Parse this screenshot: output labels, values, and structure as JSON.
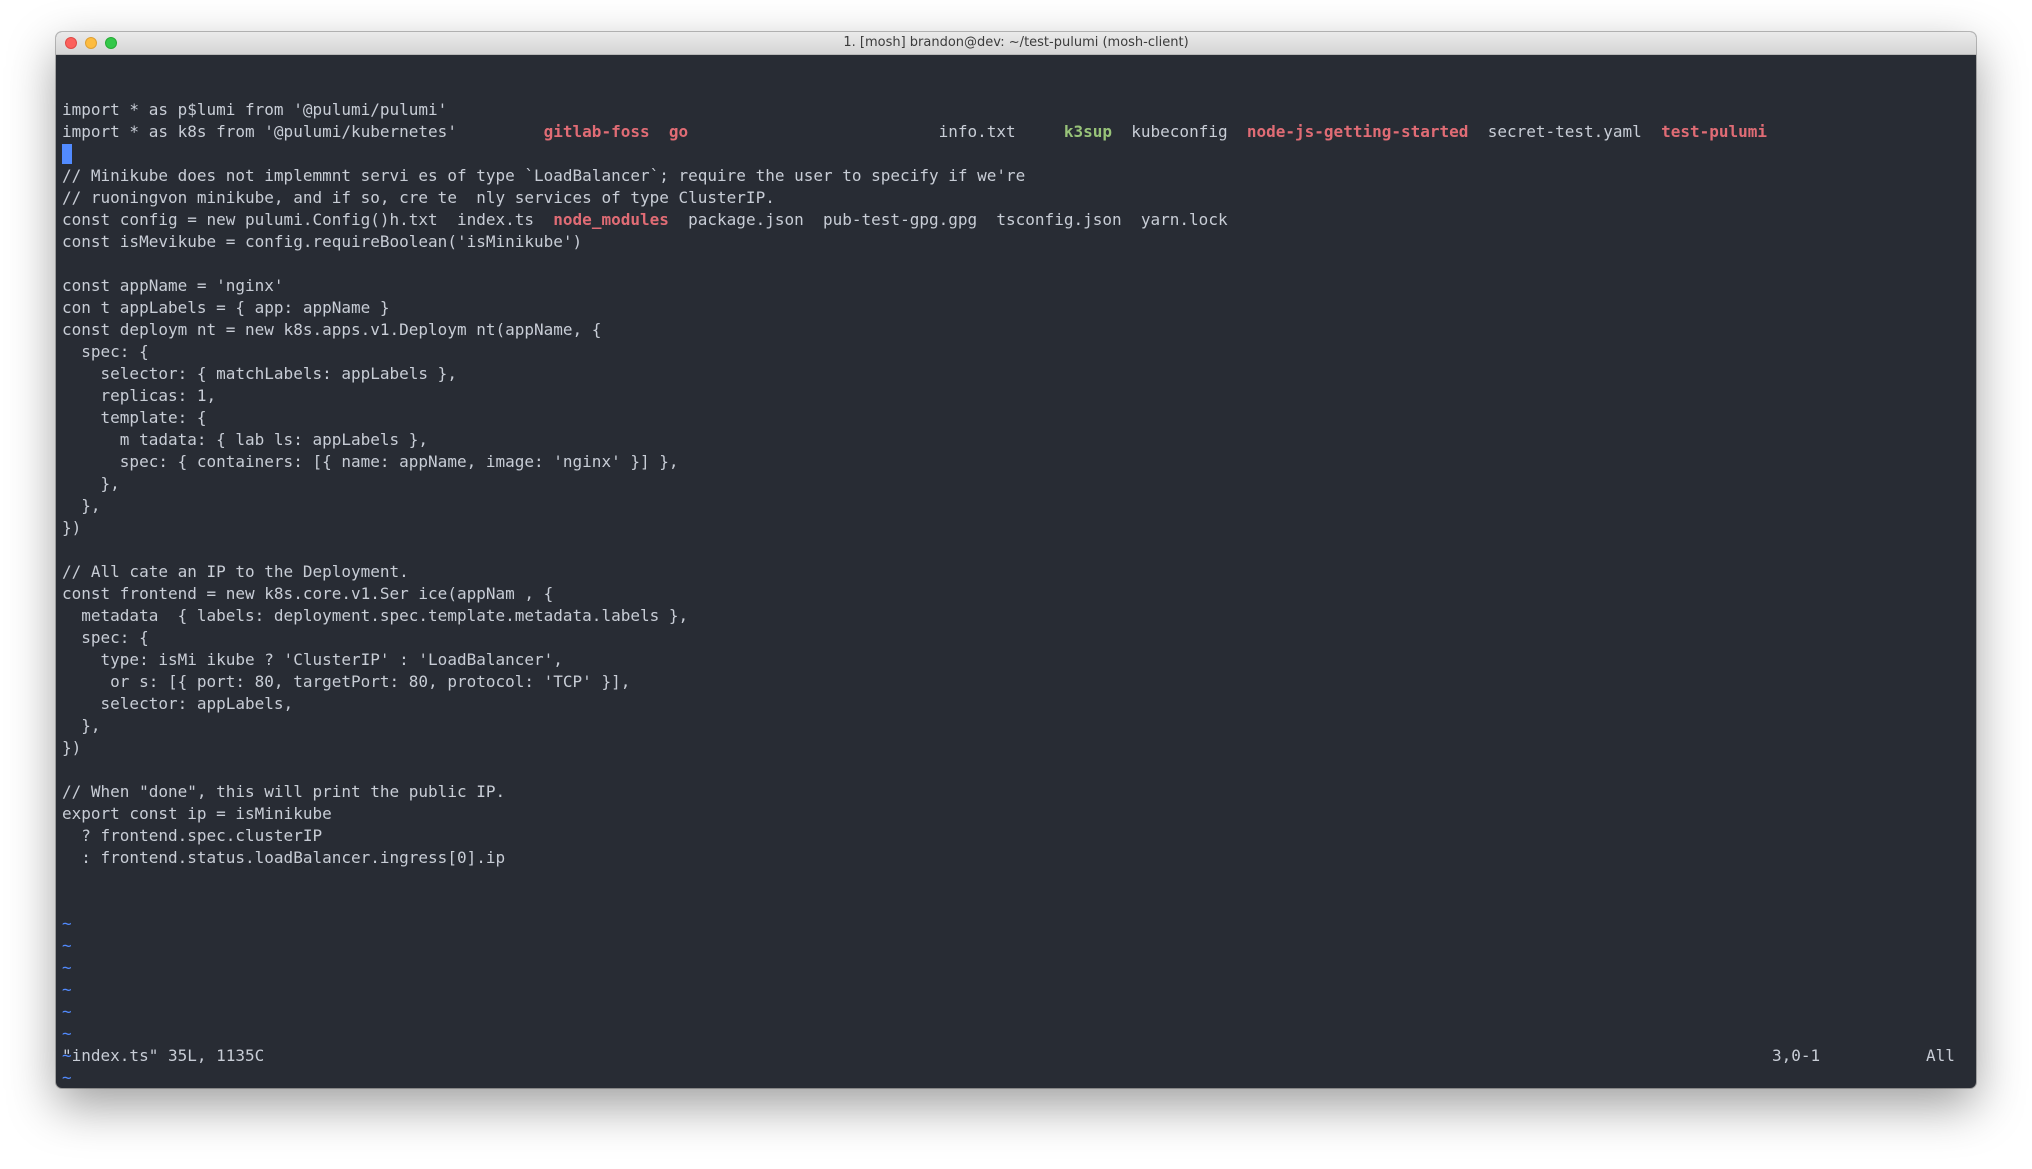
{
  "window": {
    "title": "1. [mosh] brandon@dev: ~/test-pulumi (mosh-client)"
  },
  "editor": {
    "lines": [
      {
        "segs": [
          {
            "t": "import * as p$lumi from '@pulumi/pulumi'",
            "c": "plain"
          }
        ]
      },
      {
        "segs": [
          {
            "t": "import * as k8s from '@pulumi/kubernetes'         ",
            "c": "plain"
          },
          {
            "t": "gitlab-foss",
            "c": "red"
          },
          {
            "t": "  ",
            "c": "plain"
          },
          {
            "t": "go",
            "c": "red"
          },
          {
            "t": "                          info.txt     ",
            "c": "plain"
          },
          {
            "t": "k3sup",
            "c": "green"
          },
          {
            "t": "  kubeconfig  ",
            "c": "plain"
          },
          {
            "t": "node-js-getting-started",
            "c": "red"
          },
          {
            "t": "  secret-test.yaml  ",
            "c": "plain"
          },
          {
            "t": "test-pulumi",
            "c": "red"
          }
        ]
      },
      {
        "cursor": true,
        "segs": []
      },
      {
        "segs": [
          {
            "t": "// Minikube does not implemmnt servi es of type `LoadBalancer`; require the user to specify if we're",
            "c": "plain"
          }
        ]
      },
      {
        "segs": [
          {
            "t": "// ruoningvon minikube, and if so, cre te  nly services of type ClusterIP.",
            "c": "plain"
          }
        ]
      },
      {
        "segs": [
          {
            "t": "const config = new pulumi.Config()h.txt  index.ts  ",
            "c": "plain"
          },
          {
            "t": "node_modules",
            "c": "red"
          },
          {
            "t": "  package.json  pub-test-gpg.gpg  tsconfig.json  yarn.lock",
            "c": "plain"
          }
        ]
      },
      {
        "segs": [
          {
            "t": "const isMevikube = config.requireBoolean('isMinikube')",
            "c": "plain"
          }
        ]
      },
      {
        "segs": []
      },
      {
        "segs": [
          {
            "t": "const appName = 'nginx'",
            "c": "plain"
          }
        ]
      },
      {
        "segs": [
          {
            "t": "con t appLabels = { app: appName }",
            "c": "plain"
          }
        ]
      },
      {
        "segs": [
          {
            "t": "const deploym nt = new k8s.apps.v1.Deploym nt(appName, {",
            "c": "plain"
          }
        ]
      },
      {
        "segs": [
          {
            "t": "  spec: {",
            "c": "plain"
          }
        ]
      },
      {
        "segs": [
          {
            "t": "    selector: { matchLabels: appLabels },",
            "c": "plain"
          }
        ]
      },
      {
        "segs": [
          {
            "t": "    replicas: 1,",
            "c": "plain"
          }
        ]
      },
      {
        "segs": [
          {
            "t": "    template: {",
            "c": "plain"
          }
        ]
      },
      {
        "segs": [
          {
            "t": "      m tadata: { lab ls: appLabels },",
            "c": "plain"
          }
        ]
      },
      {
        "segs": [
          {
            "t": "      spec: { containers: [{ name: appName, image: 'nginx' }] },",
            "c": "plain"
          }
        ]
      },
      {
        "segs": [
          {
            "t": "    },",
            "c": "plain"
          }
        ]
      },
      {
        "segs": [
          {
            "t": "  },",
            "c": "plain"
          }
        ]
      },
      {
        "segs": [
          {
            "t": "})",
            "c": "plain"
          }
        ]
      },
      {
        "segs": []
      },
      {
        "segs": [
          {
            "t": "// All cate an IP to the Deployment.",
            "c": "plain"
          }
        ]
      },
      {
        "segs": [
          {
            "t": "const frontend = new k8s.core.v1.Ser ice(appNam , {",
            "c": "plain"
          }
        ]
      },
      {
        "segs": [
          {
            "t": "  metadata  { labels: deployment.spec.template.metadata.labels },",
            "c": "plain"
          }
        ]
      },
      {
        "segs": [
          {
            "t": "  spec: {",
            "c": "plain"
          }
        ]
      },
      {
        "segs": [
          {
            "t": "    type: isMi ikube ? 'ClusterIP' : 'LoadBalancer',",
            "c": "plain"
          }
        ]
      },
      {
        "segs": [
          {
            "t": "     or s: [{ port: 80, targetPort: 80, protocol: 'TCP' }],",
            "c": "plain"
          }
        ]
      },
      {
        "segs": [
          {
            "t": "    selector: appLabels,",
            "c": "plain"
          }
        ]
      },
      {
        "segs": [
          {
            "t": "  },",
            "c": "plain"
          }
        ]
      },
      {
        "segs": [
          {
            "t": "})",
            "c": "plain"
          }
        ]
      },
      {
        "segs": []
      },
      {
        "segs": [
          {
            "t": "// When \"done\", this will print the public IP.",
            "c": "plain"
          }
        ]
      },
      {
        "segs": [
          {
            "t": "export const ip = isMinikube",
            "c": "plain"
          }
        ]
      },
      {
        "segs": [
          {
            "t": "  ? frontend.spec.clusterIP",
            "c": "plain"
          }
        ]
      },
      {
        "segs": [
          {
            "t": "  : frontend.status.loadBalancer.ingress[0].ip",
            "c": "plain"
          }
        ]
      }
    ],
    "tilde_char": "~",
    "tilde_count": 10,
    "status": {
      "file_info": "\"index.ts\" 35L, 1135C",
      "position": "3,0-1",
      "scroll": "All"
    }
  }
}
